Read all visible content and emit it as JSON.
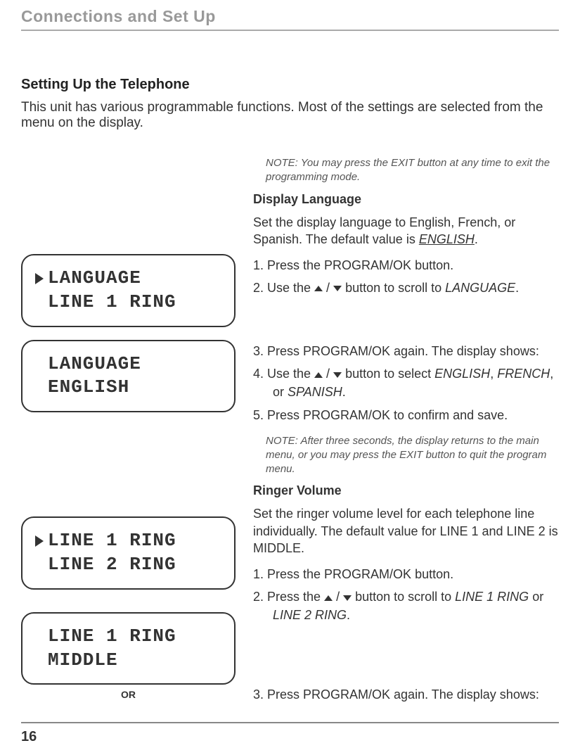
{
  "header": {
    "title": "Connections and Set Up"
  },
  "section": {
    "title": "Setting Up the Telephone",
    "intro": "This unit has various programmable functions. Most of the settings are selected from the menu on the display."
  },
  "notes": {
    "exit": "NOTE: You may press the EXIT button at any time to exit the programming mode.",
    "timeout": "NOTE: After three seconds, the display returns to the main menu, or you may press the EXIT button to quit the program menu."
  },
  "language": {
    "heading": "Display Language",
    "desc_pre": "Set the display language to English, French, or Spanish. The default value is ",
    "default": "ENGLISH",
    "desc_post": ".",
    "steps": {
      "s1": "1.   Press the PROGRAM/OK button.",
      "s2_pre": "2.   Use the ",
      "s2_post": " button to scroll to ",
      "s2_target": "LANGUAGE",
      "s2_end": ".",
      "s3": "3.   Press PROGRAM/OK again. The display shows:",
      "s4_pre": "4.   Use the ",
      "s4_post": " button to select ",
      "s4_o1": "ENGLISH",
      "s4_o2": "FRENCH",
      "s4_o3": "SPANISH",
      "s4_end": ".",
      "s5": "5.   Press PROGRAM/OK to confirm and save."
    },
    "lcd1": {
      "line1": "LANGUAGE",
      "line2": "LINE 1 RING"
    },
    "lcd2": {
      "line1": "LANGUAGE",
      "line2": "ENGLISH"
    }
  },
  "ringer": {
    "heading": "Ringer Volume",
    "desc": "Set the ringer volume level for each telephone line individually. The default value for LINE 1 and LINE 2 is MIDDLE.",
    "steps": {
      "s1": "1.   Press the PROGRAM/OK button.",
      "s2_pre": "2.   Press the ",
      "s2_post": " button to scroll to ",
      "s2_t1": "LINE 1 RING",
      "s2_or": " or ",
      "s2_t2": "LINE 2 RING",
      "s2_end": ".",
      "s3": "3.   Press PROGRAM/OK again. The display shows:"
    },
    "lcd1": {
      "line1": "LINE 1 RING",
      "line2": "LINE 2 RING"
    },
    "lcd2": {
      "line1": "LINE 1 RING",
      "line2": "MIDDLE"
    },
    "or_label": "OR"
  },
  "footer": {
    "page": "16"
  }
}
